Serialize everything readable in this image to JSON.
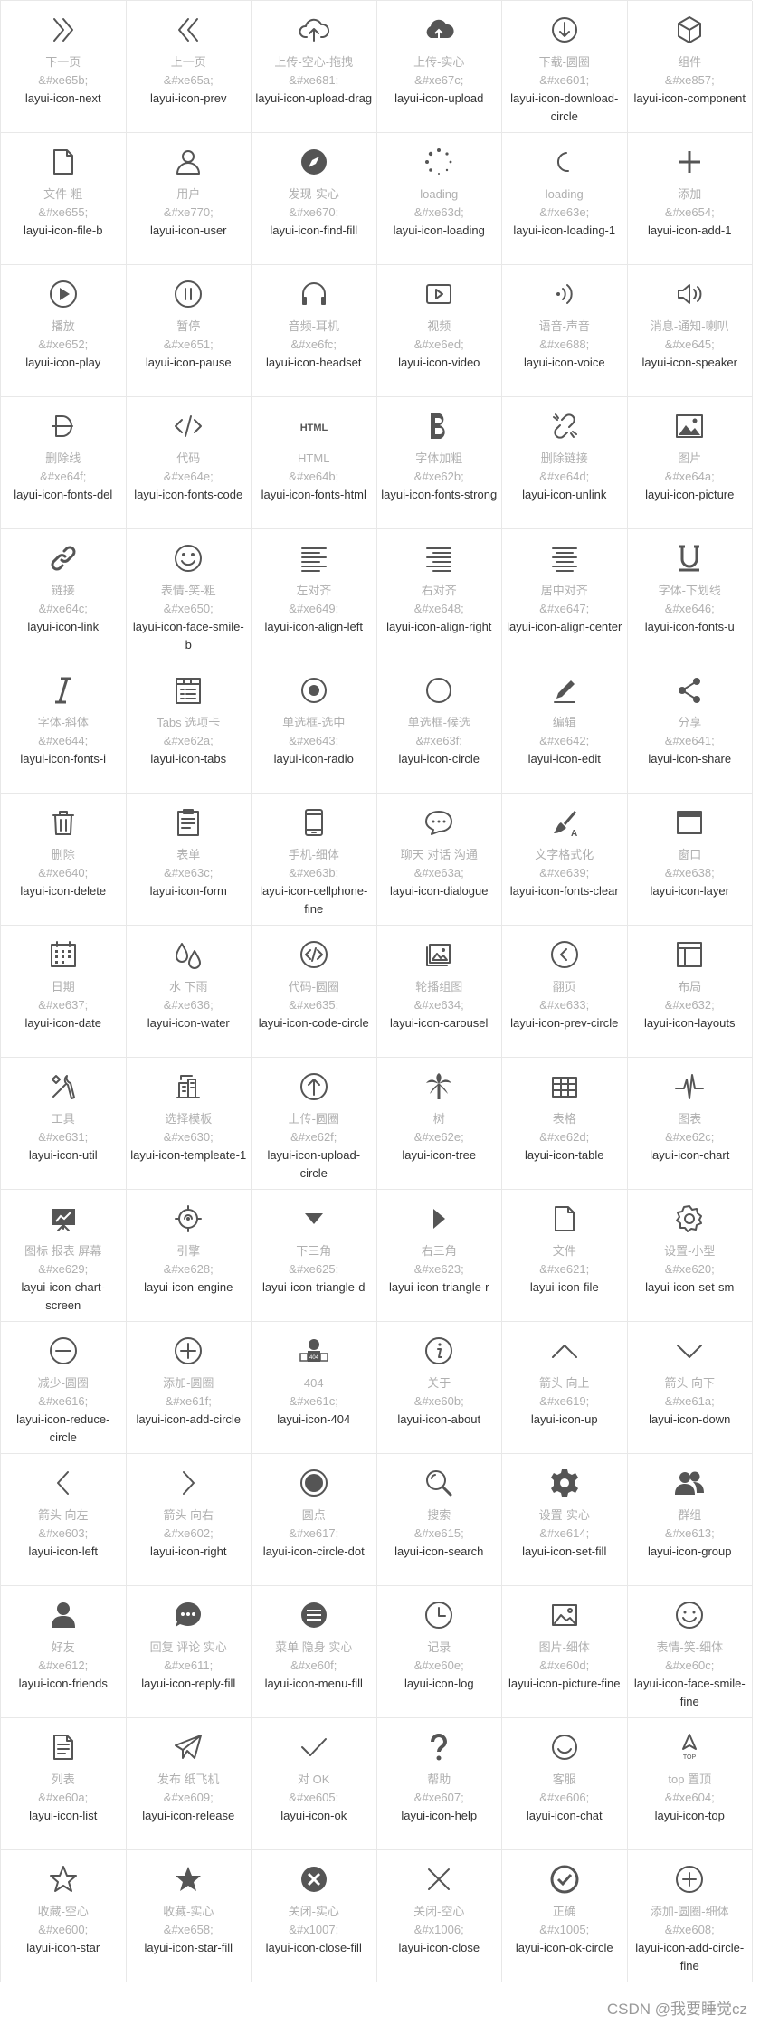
{
  "icons": [
    {
      "glyph": "next",
      "name": "下一页",
      "code": "&#xe65b;",
      "cls": "layui-icon-next"
    },
    {
      "glyph": "prev",
      "name": "上一页",
      "code": "&#xe65a;",
      "cls": "layui-icon-prev"
    },
    {
      "glyph": "upload-drag",
      "name": "上传-空心-拖拽",
      "code": "&#xe681;",
      "cls": "layui-icon-upload-drag"
    },
    {
      "glyph": "upload",
      "name": "上传-实心",
      "code": "&#xe67c;",
      "cls": "layui-icon-upload"
    },
    {
      "glyph": "download-circle",
      "name": "下载-圆圈",
      "code": "&#xe601;",
      "cls": "layui-icon-download-circle"
    },
    {
      "glyph": "component",
      "name": "组件",
      "code": "&#xe857;",
      "cls": "layui-icon-component"
    },
    {
      "glyph": "file-b",
      "name": "文件-粗",
      "code": "&#xe655;",
      "cls": "layui-icon-file-b"
    },
    {
      "glyph": "user",
      "name": "用户",
      "code": "&#xe770;",
      "cls": "layui-icon-user"
    },
    {
      "glyph": "find-fill",
      "name": "发现-实心",
      "code": "&#xe670;",
      "cls": "layui-icon-find-fill"
    },
    {
      "glyph": "loading",
      "name": "loading",
      "code": "&#xe63d;",
      "cls": "layui-icon-loading"
    },
    {
      "glyph": "loading-1",
      "name": "loading",
      "code": "&#xe63e;",
      "cls": "layui-icon-loading-1"
    },
    {
      "glyph": "add-1",
      "name": "添加",
      "code": "&#xe654;",
      "cls": "layui-icon-add-1"
    },
    {
      "glyph": "play",
      "name": "播放",
      "code": "&#xe652;",
      "cls": "layui-icon-play"
    },
    {
      "glyph": "pause",
      "name": "暂停",
      "code": "&#xe651;",
      "cls": "layui-icon-pause"
    },
    {
      "glyph": "headset",
      "name": "音频-耳机",
      "code": "&#xe6fc;",
      "cls": "layui-icon-headset"
    },
    {
      "glyph": "video",
      "name": "视频",
      "code": "&#xe6ed;",
      "cls": "layui-icon-video"
    },
    {
      "glyph": "voice",
      "name": "语音-声音",
      "code": "&#xe688;",
      "cls": "layui-icon-voice"
    },
    {
      "glyph": "speaker",
      "name": "消息-通知-喇叭",
      "code": "&#xe645;",
      "cls": "layui-icon-speaker"
    },
    {
      "glyph": "fonts-del",
      "name": "删除线",
      "code": "&#xe64f;",
      "cls": "layui-icon-fonts-del"
    },
    {
      "glyph": "fonts-code",
      "name": "代码",
      "code": "&#xe64e;",
      "cls": "layui-icon-fonts-code"
    },
    {
      "glyph": "fonts-html",
      "name": "HTML",
      "code": "&#xe64b;",
      "cls": "layui-icon-fonts-html"
    },
    {
      "glyph": "fonts-strong",
      "name": "字体加粗",
      "code": "&#xe62b;",
      "cls": "layui-icon-fonts-strong"
    },
    {
      "glyph": "unlink",
      "name": "删除链接",
      "code": "&#xe64d;",
      "cls": "layui-icon-unlink"
    },
    {
      "glyph": "picture",
      "name": "图片",
      "code": "&#xe64a;",
      "cls": "layui-icon-picture"
    },
    {
      "glyph": "link",
      "name": "链接",
      "code": "&#xe64c;",
      "cls": "layui-icon-link"
    },
    {
      "glyph": "face-smile-b",
      "name": "表情-笑-粗",
      "code": "&#xe650;",
      "cls": "layui-icon-face-smile-b"
    },
    {
      "glyph": "align-left",
      "name": "左对齐",
      "code": "&#xe649;",
      "cls": "layui-icon-align-left"
    },
    {
      "glyph": "align-right",
      "name": "右对齐",
      "code": "&#xe648;",
      "cls": "layui-icon-align-right"
    },
    {
      "glyph": "align-center",
      "name": "居中对齐",
      "code": "&#xe647;",
      "cls": "layui-icon-align-center"
    },
    {
      "glyph": "fonts-u",
      "name": "字体-下划线",
      "code": "&#xe646;",
      "cls": "layui-icon-fonts-u"
    },
    {
      "glyph": "fonts-i",
      "name": "字体-斜体",
      "code": "&#xe644;",
      "cls": "layui-icon-fonts-i"
    },
    {
      "glyph": "tabs",
      "name": "Tabs 选项卡",
      "code": "&#xe62a;",
      "cls": "layui-icon-tabs"
    },
    {
      "glyph": "radio",
      "name": "单选框-选中",
      "code": "&#xe643;",
      "cls": "layui-icon-radio"
    },
    {
      "glyph": "circle",
      "name": "单选框-候选",
      "code": "&#xe63f;",
      "cls": "layui-icon-circle"
    },
    {
      "glyph": "edit",
      "name": "编辑",
      "code": "&#xe642;",
      "cls": "layui-icon-edit"
    },
    {
      "glyph": "share",
      "name": "分享",
      "code": "&#xe641;",
      "cls": "layui-icon-share"
    },
    {
      "glyph": "delete",
      "name": "删除",
      "code": "&#xe640;",
      "cls": "layui-icon-delete"
    },
    {
      "glyph": "form",
      "name": "表单",
      "code": "&#xe63c;",
      "cls": "layui-icon-form"
    },
    {
      "glyph": "cellphone-fine",
      "name": "手机-细体",
      "code": "&#xe63b;",
      "cls": "layui-icon-cellphone-fine"
    },
    {
      "glyph": "dialogue",
      "name": "聊天 对话 沟通",
      "code": "&#xe63a;",
      "cls": "layui-icon-dialogue"
    },
    {
      "glyph": "fonts-clear",
      "name": "文字格式化",
      "code": "&#xe639;",
      "cls": "layui-icon-fonts-clear"
    },
    {
      "glyph": "layer",
      "name": "窗口",
      "code": "&#xe638;",
      "cls": "layui-icon-layer"
    },
    {
      "glyph": "date",
      "name": "日期",
      "code": "&#xe637;",
      "cls": "layui-icon-date"
    },
    {
      "glyph": "water",
      "name": "水 下雨",
      "code": "&#xe636;",
      "cls": "layui-icon-water"
    },
    {
      "glyph": "code-circle",
      "name": "代码-圆圈",
      "code": "&#xe635;",
      "cls": "layui-icon-code-circle"
    },
    {
      "glyph": "carousel",
      "name": "轮播组图",
      "code": "&#xe634;",
      "cls": "layui-icon-carousel"
    },
    {
      "glyph": "prev-circle",
      "name": "翻页",
      "code": "&#xe633;",
      "cls": "layui-icon-prev-circle"
    },
    {
      "glyph": "layouts",
      "name": "布局",
      "code": "&#xe632;",
      "cls": "layui-icon-layouts"
    },
    {
      "glyph": "util",
      "name": "工具",
      "code": "&#xe631;",
      "cls": "layui-icon-util"
    },
    {
      "glyph": "templeate-1",
      "name": "选择模板",
      "code": "&#xe630;",
      "cls": "layui-icon-templeate-1"
    },
    {
      "glyph": "upload-circle",
      "name": "上传-圆圈",
      "code": "&#xe62f;",
      "cls": "layui-icon-upload-circle"
    },
    {
      "glyph": "tree",
      "name": "树",
      "code": "&#xe62e;",
      "cls": "layui-icon-tree"
    },
    {
      "glyph": "table",
      "name": "表格",
      "code": "&#xe62d;",
      "cls": "layui-icon-table"
    },
    {
      "glyph": "chart",
      "name": "图表",
      "code": "&#xe62c;",
      "cls": "layui-icon-chart"
    },
    {
      "glyph": "chart-screen",
      "name": "图标 报表 屏幕",
      "code": "&#xe629;",
      "cls": "layui-icon-chart-screen"
    },
    {
      "glyph": "engine",
      "name": "引擎",
      "code": "&#xe628;",
      "cls": "layui-icon-engine"
    },
    {
      "glyph": "triangle-d",
      "name": "下三角",
      "code": "&#xe625;",
      "cls": "layui-icon-triangle-d"
    },
    {
      "glyph": "triangle-r",
      "name": "右三角",
      "code": "&#xe623;",
      "cls": "layui-icon-triangle-r"
    },
    {
      "glyph": "file",
      "name": "文件",
      "code": "&#xe621;",
      "cls": "layui-icon-file"
    },
    {
      "glyph": "set-sm",
      "name": "设置-小型",
      "code": "&#xe620;",
      "cls": "layui-icon-set-sm"
    },
    {
      "glyph": "reduce-circle",
      "name": "减少-圆圈",
      "code": "&#xe616;",
      "cls": "layui-icon-reduce-circle"
    },
    {
      "glyph": "add-circle",
      "name": "添加-圆圈",
      "code": "&#xe61f;",
      "cls": "layui-icon-add-circle"
    },
    {
      "glyph": "404",
      "name": "404",
      "code": "&#xe61c;",
      "cls": "layui-icon-404"
    },
    {
      "glyph": "about",
      "name": "关于",
      "code": "&#xe60b;",
      "cls": "layui-icon-about"
    },
    {
      "glyph": "up",
      "name": "箭头 向上",
      "code": "&#xe619;",
      "cls": "layui-icon-up"
    },
    {
      "glyph": "down",
      "name": "箭头 向下",
      "code": "&#xe61a;",
      "cls": "layui-icon-down"
    },
    {
      "glyph": "left",
      "name": "箭头 向左",
      "code": "&#xe603;",
      "cls": "layui-icon-left"
    },
    {
      "glyph": "right",
      "name": "箭头 向右",
      "code": "&#xe602;",
      "cls": "layui-icon-right"
    },
    {
      "glyph": "circle-dot",
      "name": "圆点",
      "code": "&#xe617;",
      "cls": "layui-icon-circle-dot"
    },
    {
      "glyph": "search",
      "name": "搜索",
      "code": "&#xe615;",
      "cls": "layui-icon-search"
    },
    {
      "glyph": "set-fill",
      "name": "设置-实心",
      "code": "&#xe614;",
      "cls": "layui-icon-set-fill"
    },
    {
      "glyph": "group",
      "name": "群组",
      "code": "&#xe613;",
      "cls": "layui-icon-group"
    },
    {
      "glyph": "friends",
      "name": "好友",
      "code": "&#xe612;",
      "cls": "layui-icon-friends"
    },
    {
      "glyph": "reply-fill",
      "name": "回复 评论 实心",
      "code": "&#xe611;",
      "cls": "layui-icon-reply-fill"
    },
    {
      "glyph": "menu-fill",
      "name": "菜单 隐身 实心",
      "code": "&#xe60f;",
      "cls": "layui-icon-menu-fill"
    },
    {
      "glyph": "log",
      "name": "记录",
      "code": "&#xe60e;",
      "cls": "layui-icon-log"
    },
    {
      "glyph": "picture-fine",
      "name": "图片-细体",
      "code": "&#xe60d;",
      "cls": "layui-icon-picture-fine"
    },
    {
      "glyph": "face-smile-fine",
      "name": "表情-笑-细体",
      "code": "&#xe60c;",
      "cls": "layui-icon-face-smile-fine"
    },
    {
      "glyph": "list",
      "name": "列表",
      "code": "&#xe60a;",
      "cls": "layui-icon-list"
    },
    {
      "glyph": "release",
      "name": "发布 纸飞机",
      "code": "&#xe609;",
      "cls": "layui-icon-release"
    },
    {
      "glyph": "ok",
      "name": "对 OK",
      "code": "&#xe605;",
      "cls": "layui-icon-ok"
    },
    {
      "glyph": "help",
      "name": "帮助",
      "code": "&#xe607;",
      "cls": "layui-icon-help"
    },
    {
      "glyph": "chat",
      "name": "客服",
      "code": "&#xe606;",
      "cls": "layui-icon-chat"
    },
    {
      "glyph": "top",
      "name": "top 置顶",
      "code": "&#xe604;",
      "cls": "layui-icon-top"
    },
    {
      "glyph": "star",
      "name": "收藏-空心",
      "code": "&#xe600;",
      "cls": "layui-icon-star"
    },
    {
      "glyph": "star-fill",
      "name": "收藏-实心",
      "code": "&#xe658;",
      "cls": "layui-icon-star-fill"
    },
    {
      "glyph": "close-fill",
      "name": "关闭-实心",
      "code": "&#x1007;",
      "cls": "layui-icon-close-fill"
    },
    {
      "glyph": "close",
      "name": "关闭-空心",
      "code": "&#x1006;",
      "cls": "layui-icon-close"
    },
    {
      "glyph": "ok-circle",
      "name": "正确",
      "code": "&#x1005;",
      "cls": "layui-icon-ok-circle"
    },
    {
      "glyph": "add-circle-fine",
      "name": "添加-圆圈-细体",
      "code": "&#xe608;",
      "cls": "layui-icon-add-circle-fine"
    }
  ],
  "watermark": "CSDN @我要睡觉cz"
}
